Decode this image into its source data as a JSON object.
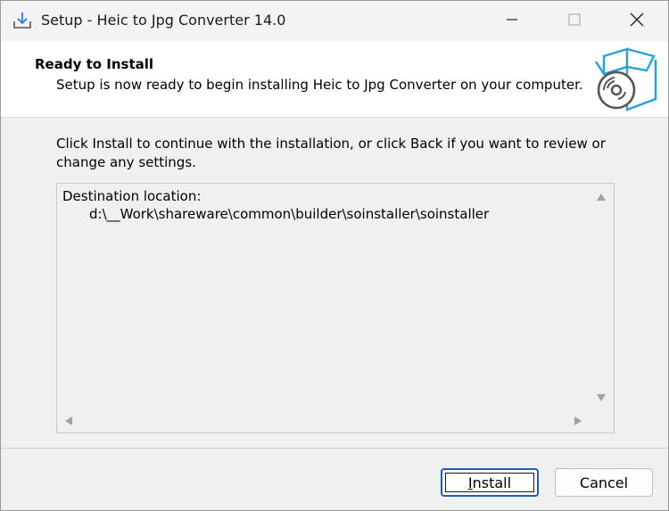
{
  "window": {
    "title": "Setup - Heic to Jpg Converter 14.0",
    "icons": {
      "app": "setup-download-icon",
      "minimize": "minimize-icon",
      "maximize": "maximize-icon",
      "close": "close-icon",
      "wizard": "software-box-cd-icon"
    }
  },
  "header": {
    "title": "Ready to Install",
    "subtitle": "Setup is now ready to begin installing Heic to Jpg Converter on your computer."
  },
  "body": {
    "intro": "Click Install to continue with the installation, or click Back if you want to review or change any settings.",
    "memo": {
      "line1": "Destination location:",
      "line2": "d:\\__Work\\shareware\\common\\builder\\soinstaller\\soinstaller"
    }
  },
  "buttons": {
    "install_first": "I",
    "install_rest": "nstall",
    "cancel": "Cancel"
  },
  "colors": {
    "accent": "#1f5fb2",
    "box_icon": "#2aa0d8"
  }
}
